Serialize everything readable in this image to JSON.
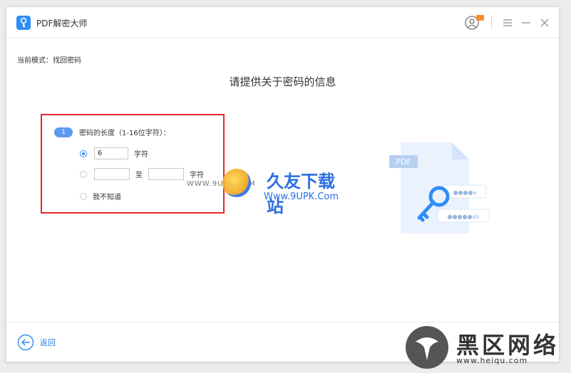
{
  "app": {
    "title": "PDF解密大师"
  },
  "mode": {
    "label": "当前模式：",
    "value": "找回密码"
  },
  "main": {
    "title": "请提供关于密码的信息"
  },
  "step": {
    "number": "1",
    "label": "密码的长度（1-16位字符）：",
    "options": {
      "exact": {
        "value": "6",
        "unit": "字符",
        "checked": true
      },
      "range": {
        "from": "",
        "sep": "至",
        "to": "",
        "unit": "字符",
        "checked": false
      },
      "unknown": {
        "label": "我不知道",
        "checked": false
      }
    }
  },
  "illustration": {
    "doc_label": "PDF",
    "field1_mask": "●●●●a",
    "field2_mask": "●●●●●ab"
  },
  "footer": {
    "back_label": "返回"
  },
  "watermarks": {
    "site1_name": "久友下载站",
    "site1_url": "Www.9UPK.Com",
    "site1_www": "WWW.9UPK.COM",
    "site2_name": "黑区网络",
    "site2_url": "www.heiqu.com"
  },
  "colors": {
    "accent": "#2f8df5",
    "highlight_border": "#e6262b",
    "step_badge": "#5a9bf2"
  }
}
